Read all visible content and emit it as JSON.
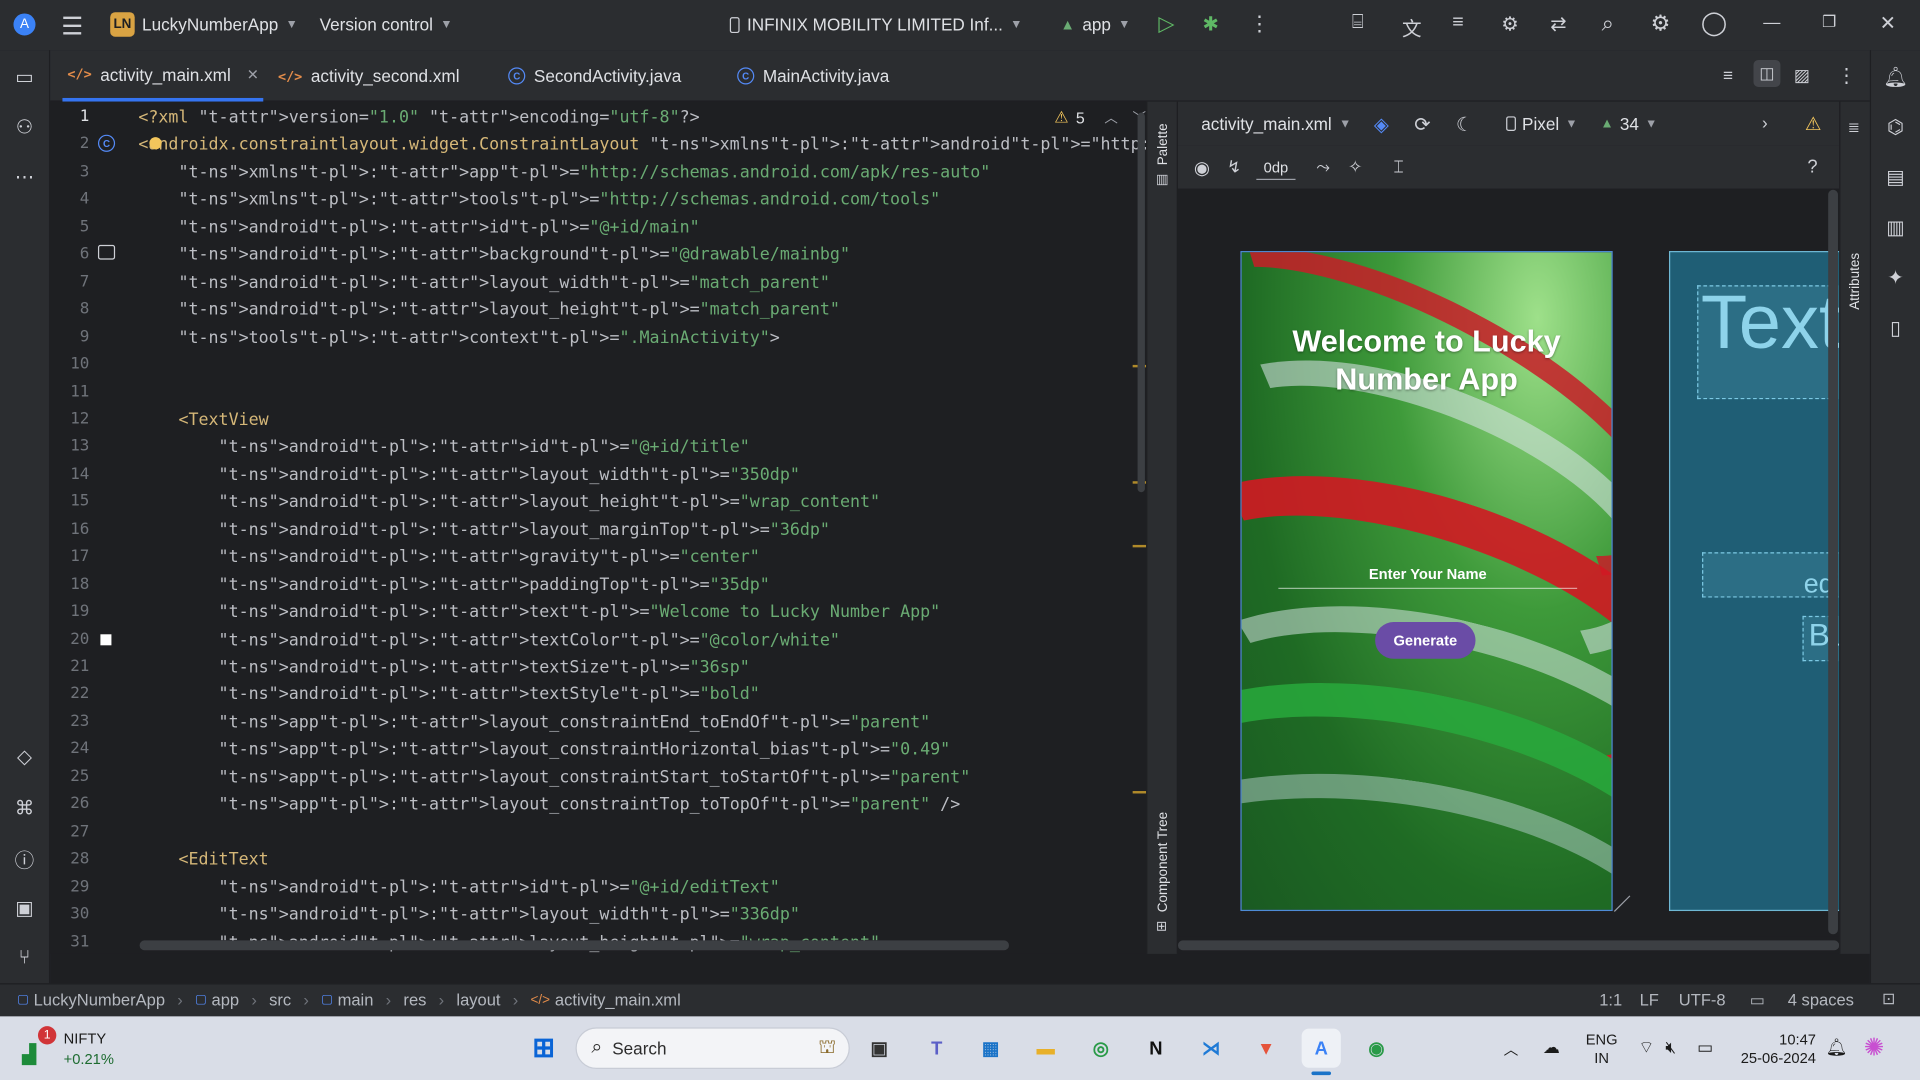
{
  "titlebar": {
    "project_badge": "LN",
    "project_name": "LuckyNumberApp",
    "vcs_label": "Version control",
    "device_label": "INFINIX MOBILITY LIMITED Inf...",
    "run_config": "app"
  },
  "tabs": [
    {
      "label": "activity_main.xml",
      "icon": "xml-icon",
      "active": true
    },
    {
      "label": "activity_second.xml",
      "icon": "xml-icon",
      "active": false
    },
    {
      "label": "SecondActivity.java",
      "icon": "java-class-icon",
      "active": false
    },
    {
      "label": "MainActivity.java",
      "icon": "java-class-icon",
      "active": false
    }
  ],
  "editor": {
    "warning_count": "5",
    "line_numbers": [
      "1",
      "2",
      "3",
      "4",
      "5",
      "6",
      "7",
      "8",
      "9",
      "10",
      "11",
      "12",
      "13",
      "14",
      "15",
      "16",
      "17",
      "18",
      "19",
      "20",
      "21",
      "22",
      "23",
      "24",
      "25",
      "26",
      "27",
      "28",
      "29",
      "30",
      "31"
    ],
    "lines": [
      "<?xml version=\"1.0\" encoding=\"utf-8\"?>",
      "<androidx.constraintlayout.widget.ConstraintLayout xmlns:android=\"http://schemas.android.com/apk/res/",
      "    xmlns:app=\"http://schemas.android.com/apk/res-auto\"",
      "    xmlns:tools=\"http://schemas.android.com/tools\"",
      "    android:id=\"@+id/main\"",
      "    android:background=\"@drawable/mainbg\"",
      "    android:layout_width=\"match_parent\"",
      "    android:layout_height=\"match_parent\"",
      "    tools:context=\".MainActivity\">",
      "",
      "",
      "    <TextView",
      "        android:id=\"@+id/title\"",
      "        android:layout_width=\"350dp\"",
      "        android:layout_height=\"wrap_content\"",
      "        android:layout_marginTop=\"36dp\"",
      "        android:gravity=\"center\"",
      "        android:paddingTop=\"35dp\"",
      "        android:text=\"Welcome to Lucky Number App\"",
      "        android:textColor=\"@color/white\"",
      "        android:textSize=\"36sp\"",
      "        android:textStyle=\"bold\"",
      "        app:layout_constraintEnd_toEndOf=\"parent\"",
      "        app:layout_constraintHorizontal_bias=\"0.49\"",
      "        app:layout_constraintStart_toStartOf=\"parent\"",
      "        app:layout_constraintTop_toTopOf=\"parent\" />",
      "",
      "    <EditText",
      "        android:id=\"@+id/editText\"",
      "        android:layout_width=\"336dp\"",
      "        android:layout_height=\"wrap_content\""
    ]
  },
  "side_strips": {
    "palette": "Palette",
    "component_tree": "Component Tree",
    "attributes": "Attributes"
  },
  "design": {
    "file_selector": "activity_main.xml",
    "device": "Pixel",
    "api_level": "34",
    "margin_default": "0dp",
    "help": "?",
    "preview": {
      "title": "Welcome to Lucky Number App",
      "hint": "Enter Your Name",
      "button": "Generate"
    },
    "blueprint": {
      "text_label": "Text",
      "edit_label": "edi",
      "button_label": "Bu"
    }
  },
  "statusbar": {
    "breadcrumbs": [
      "LuckyNumberApp",
      "app",
      "src",
      "main",
      "res",
      "layout",
      "activity_main.xml"
    ],
    "position": "1:1",
    "line_sep": "LF",
    "encoding": "UTF-8",
    "indent": "4 spaces"
  },
  "taskbar": {
    "stock_name": "NIFTY",
    "stock_change": "+0.21%",
    "stock_badge": "1",
    "search_label": "Search",
    "lang_top": "ENG",
    "lang_bottom": "IN",
    "time": "10:47",
    "date": "25-06-2024"
  },
  "colors": {
    "accent": "#3574f0",
    "ide_bg": "#1e1f22",
    "panel_bg": "#2b2d30",
    "button_purple": "#6a4ca6",
    "blueprint_bg": "#1f5e75",
    "warning": "#f2c55c"
  }
}
